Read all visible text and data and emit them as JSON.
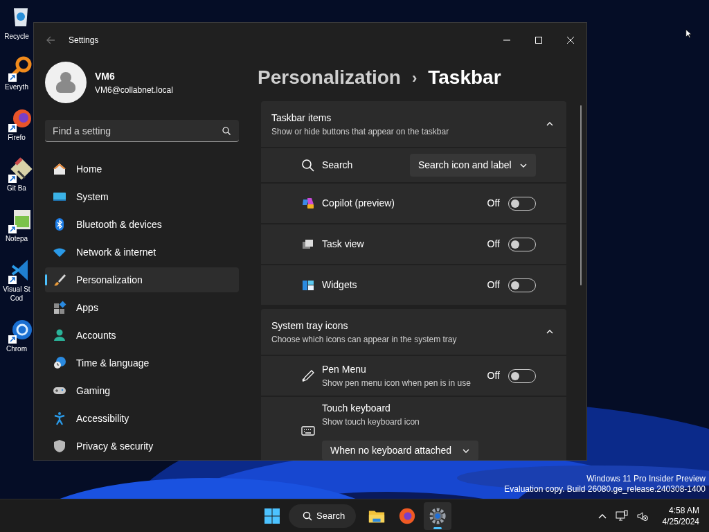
{
  "desktop_icons": [
    {
      "shortcut": false,
      "label_lines": [
        "Recycle"
      ]
    },
    {
      "shortcut": true,
      "label_lines": [
        "Everyth"
      ]
    },
    {
      "shortcut": true,
      "label_lines": [
        "Firefo"
      ]
    },
    {
      "shortcut": true,
      "label_lines": [
        "Git Ba"
      ]
    },
    {
      "shortcut": true,
      "label_lines": [
        "Notepa"
      ]
    },
    {
      "shortcut": true,
      "label_lines": [
        "Visual St",
        "Cod"
      ]
    },
    {
      "shortcut": true,
      "label_lines": [
        "Chrom"
      ]
    }
  ],
  "window": {
    "title": "Settings"
  },
  "profile": {
    "name": "VM6",
    "email": "VM6@collabnet.local"
  },
  "search": {
    "placeholder": "Find a setting"
  },
  "nav": [
    {
      "label": "Home",
      "selected": false
    },
    {
      "label": "System",
      "selected": false
    },
    {
      "label": "Bluetooth & devices",
      "selected": false
    },
    {
      "label": "Network & internet",
      "selected": false
    },
    {
      "label": "Personalization",
      "selected": true
    },
    {
      "label": "Apps",
      "selected": false
    },
    {
      "label": "Accounts",
      "selected": false
    },
    {
      "label": "Time & language",
      "selected": false
    },
    {
      "label": "Gaming",
      "selected": false
    },
    {
      "label": "Accessibility",
      "selected": false
    },
    {
      "label": "Privacy & security",
      "selected": false
    }
  ],
  "breadcrumb": {
    "parent": "Personalization",
    "separator": "›",
    "current": "Taskbar"
  },
  "sections": [
    {
      "title": "Taskbar items",
      "subtitle": "Show or hide buttons that appear on the taskbar",
      "expanded": true,
      "rows": [
        {
          "kind": "dropdown",
          "label": "Search",
          "value": "Search icon and label"
        },
        {
          "kind": "toggle",
          "label": "Copilot (preview)",
          "state_text": "Off",
          "on": false
        },
        {
          "kind": "toggle",
          "label": "Task view",
          "state_text": "Off",
          "on": false
        },
        {
          "kind": "toggle",
          "label": "Widgets",
          "state_text": "Off",
          "on": false
        }
      ]
    },
    {
      "title": "System tray icons",
      "subtitle": "Choose which icons can appear in the system tray",
      "expanded": true,
      "rows": [
        {
          "kind": "toggle",
          "label": "Pen Menu",
          "description": "Show pen menu icon when pen is in use",
          "state_text": "Off",
          "on": false
        },
        {
          "kind": "dropdown_below",
          "label": "Touch keyboard",
          "description": "Show touch keyboard icon",
          "value": "When no keyboard attached"
        }
      ]
    }
  ],
  "watermark_lines": [
    "Windows 11 Pro Insider Preview",
    "Evaluation copy. Build 26080.ge_release.240308-1400"
  ],
  "taskbar": {
    "search_label": "Search",
    "apps": [
      {
        "selected": false
      },
      {
        "selected": false
      },
      {
        "selected": true
      }
    ],
    "time": "4:58 AM",
    "date": "4/25/2024"
  }
}
